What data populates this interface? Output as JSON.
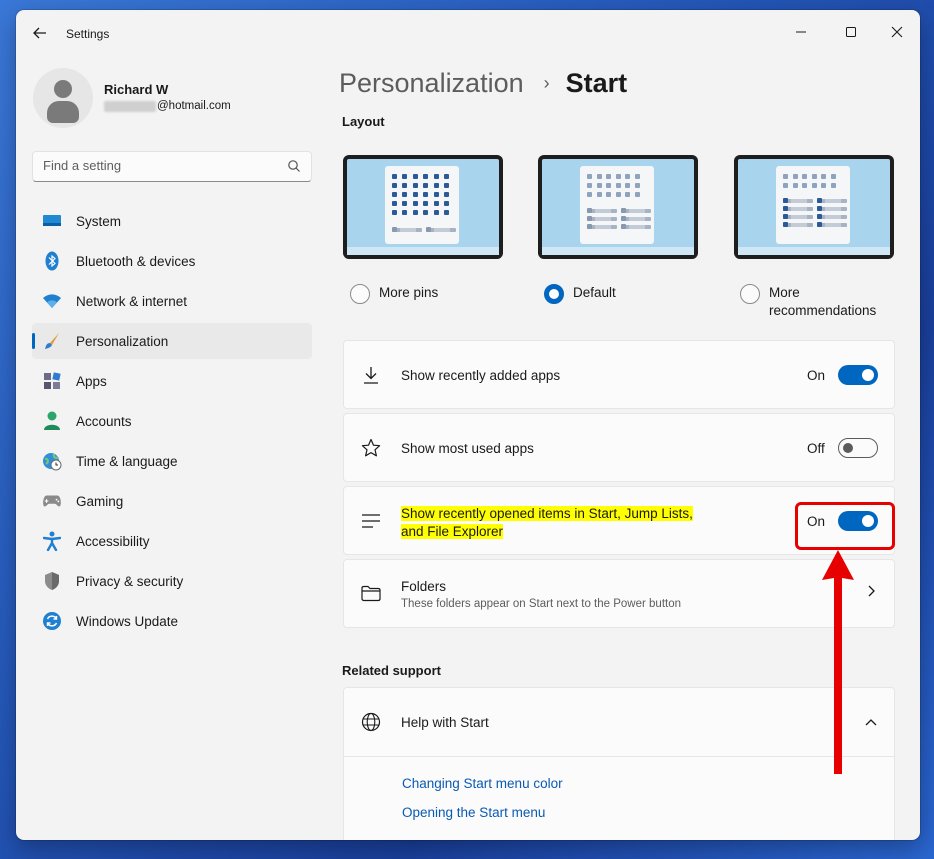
{
  "titlebar": {
    "app_title": "Settings",
    "back_icon": "arrow-left-icon",
    "minimize_icon": "minimize-icon",
    "maximize_icon": "maximize-icon",
    "close_icon": "close-icon"
  },
  "user": {
    "name": "Richard W",
    "email_visible": "@hotmail.com"
  },
  "search": {
    "placeholder": "Find a setting",
    "icon": "search-icon"
  },
  "nav": {
    "items": [
      {
        "label": "System",
        "icon": "system-icon",
        "active": false
      },
      {
        "label": "Bluetooth & devices",
        "icon": "bluetooth-icon",
        "active": false
      },
      {
        "label": "Network & internet",
        "icon": "wifi-icon",
        "active": false
      },
      {
        "label": "Personalization",
        "icon": "brush-icon",
        "active": true
      },
      {
        "label": "Apps",
        "icon": "apps-icon",
        "active": false
      },
      {
        "label": "Accounts",
        "icon": "accounts-icon",
        "active": false
      },
      {
        "label": "Time & language",
        "icon": "clock-globe-icon",
        "active": false
      },
      {
        "label": "Gaming",
        "icon": "gamepad-icon",
        "active": false
      },
      {
        "label": "Accessibility",
        "icon": "accessibility-icon",
        "active": false
      },
      {
        "label": "Privacy & security",
        "icon": "shield-icon",
        "active": false
      },
      {
        "label": "Windows Update",
        "icon": "update-icon",
        "active": false
      }
    ]
  },
  "main": {
    "breadcrumb": {
      "parent": "Personalization",
      "separator": "›",
      "current": "Start"
    },
    "layout_section": {
      "label": "Layout",
      "options": [
        {
          "label": "More pins",
          "selected": false
        },
        {
          "label": "Default",
          "selected": true
        },
        {
          "label": "More\nrecommendations",
          "label_line1": "More",
          "label_line2": "recommendations",
          "selected": false
        }
      ]
    },
    "settings": {
      "recently_added": {
        "label": "Show recently added apps",
        "state": "On",
        "icon": "download-icon"
      },
      "most_used": {
        "label": "Show most used apps",
        "state": "Off",
        "icon": "star-icon"
      },
      "recently_opened": {
        "label": "Show recently opened items in Start, Jump Lists,",
        "label_line2": "and File Explorer",
        "state": "On",
        "icon": "list-lines-icon"
      },
      "folders": {
        "label": "Folders",
        "description": "These folders appear on Start next to the Power button",
        "icon": "folder-icon"
      }
    },
    "related_support": {
      "label": "Related support",
      "help": {
        "title": "Help with Start",
        "icon": "globe-icon",
        "links": [
          "Changing Start menu color",
          "Opening the Start menu"
        ]
      }
    }
  },
  "colors": {
    "accent": "#0067c0",
    "highlight": "#ffff00",
    "annotation_red": "#e60000"
  }
}
